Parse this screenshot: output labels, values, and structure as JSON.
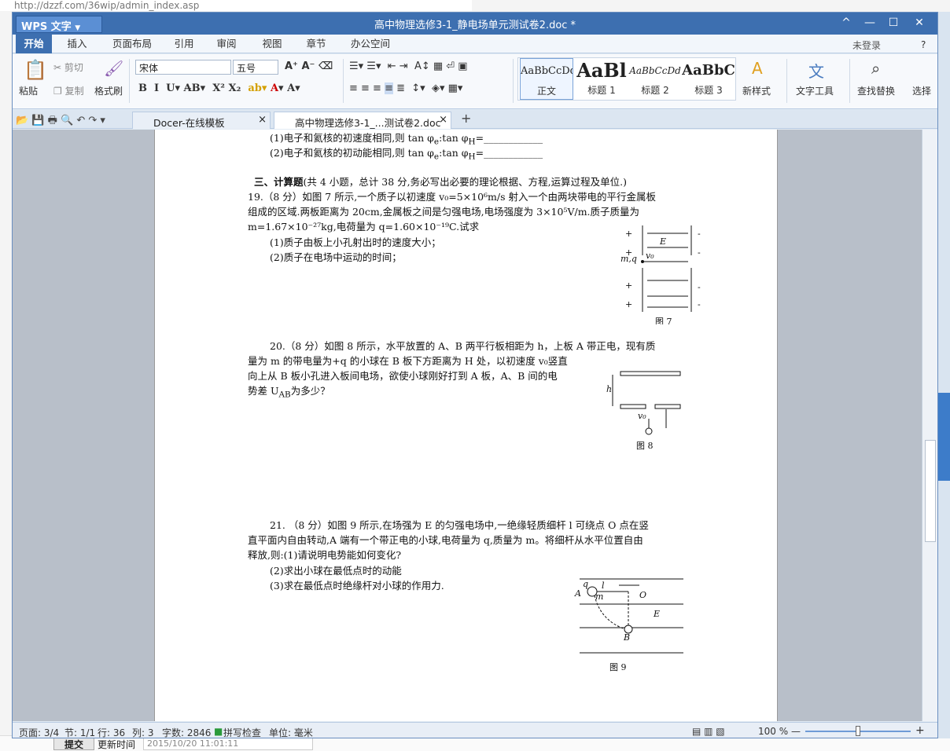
{
  "background": {
    "url": "http://dzzf.com/36wip/admin_index.asp",
    "submit_label": "提交",
    "update_label": "更新时间",
    "update_value": "2015/10/20 11:01:11"
  },
  "titlebar": {
    "app_label": "WPS 文字",
    "doc_title": "高中物理选修3-1_静电场单元测试卷2.doc *",
    "min": "—",
    "max": "☐",
    "close": "✕",
    "up": "^"
  },
  "menu": {
    "tabs": [
      "开始",
      "插入",
      "页面布局",
      "引用",
      "审阅",
      "视图",
      "章节",
      "办公空间"
    ],
    "login": "未登录",
    "help": "?"
  },
  "ribbon": {
    "paste": "粘贴",
    "cut": "剪切",
    "copy": "复制",
    "format_painter": "格式刷",
    "font_name": "宋体",
    "font_size": "五号",
    "styles": [
      {
        "sample": "AaBbCcDd",
        "label": "正文"
      },
      {
        "sample": "AaBl",
        "label": "标题 1"
      },
      {
        "sample": "AaBbCcDd",
        "label": "标题 2"
      },
      {
        "sample": "AaBbC",
        "label": "标题 3"
      }
    ],
    "new_style": "新样式",
    "text_tools": "文字工具",
    "find_replace": "查找替换",
    "select": "选择"
  },
  "tabs": [
    {
      "label": "Docer-在线模板",
      "close": "×"
    },
    {
      "label": "高中物理选修3-1_...测试卷2.doc *",
      "close": "×"
    }
  ],
  "document": {
    "l1": "(1)电子和氦核的初速度相同,则 tan φ",
    "l1s": "e",
    "l1b": ":tan φ",
    "l1s2": "H",
    "l1c": "=____________",
    "l2": "(2)电子和氦核的初动能相同,则 tan φ",
    "l2c": "=____________",
    "sec3_title": "三、计算题",
    "sec3_rest": "(共 4 小题，总计 38 分,务必写出必要的理论根据、方程,运算过程及单位.)",
    "q19_1": "19.（8 分）如图 7 所示,一个质子以初速度 v₀=5×10⁶m/s 射入一个由两块带电的平行金属板",
    "q19_2": "组成的区域.两板距离为 20cm,金属板之间是匀强电场,电场强度为 3×10⁵V/m.质子质量为",
    "q19_3": "m=1.67×10⁻²⁷kg,电荷量为 q=1.60×10⁻¹⁹C.试求",
    "q19_a": "(1)质子由板上小孔射出时的速度大小；",
    "q19_b": "(2)质子在电场中运动的时间；",
    "fig7": "图 7",
    "fig7_E": "E",
    "fig7_mq": "m,q",
    "fig7_v0": "v₀",
    "q20_1": "20.（8 分）如图 8 所示，水平放置的 A、B 两平行板相距为 h，上板 A 带正电，现有质",
    "q20_2": "量为 m 的带电量为+q 的小球在 B 板下方距离为 H 处，以初速度 v₀竖直",
    "q20_3": "向上从 B 板小孔进入板间电场，欲使小球刚好打到 A 板，A、B 间的电",
    "q20_4": "势差 U",
    "q20_4s": "AB",
    "q20_4b": "为多少？",
    "fig8": "图 8",
    "fig8_h": "h",
    "fig8_v0": "v₀",
    "q21_1": "21. （8 分）如图 9 所示,在场强为 E 的匀强电场中,一绝缘轻质细杆 l 可绕点 O 点在竖",
    "q21_2": "直平面内自由转动,A 端有一个带正电的小球,电荷量为 q,质量为 m。将细杆从水平位置自由",
    "q21_3": "释放,则:(1)请说明电势能如何变化?",
    "q21_a": "(2)求出小球在最低点时的动能",
    "q21_b": "(3)求在最低点时绝缘杆对小球的作用力.",
    "fig9": "图 9",
    "fig9_q": "q",
    "fig9_l": "l",
    "fig9_A": "A",
    "fig9_m": "m",
    "fig9_O": "O",
    "fig9_E": "E",
    "fig9_B": "B"
  },
  "status": {
    "page": "页面: 3/4",
    "section": "节: 1/1",
    "row": "行: 36",
    "col": "列: 3",
    "words": "字数: 2846",
    "spell": "拼写检查",
    "unit": "单位: 毫米",
    "zoom": "100 %"
  }
}
